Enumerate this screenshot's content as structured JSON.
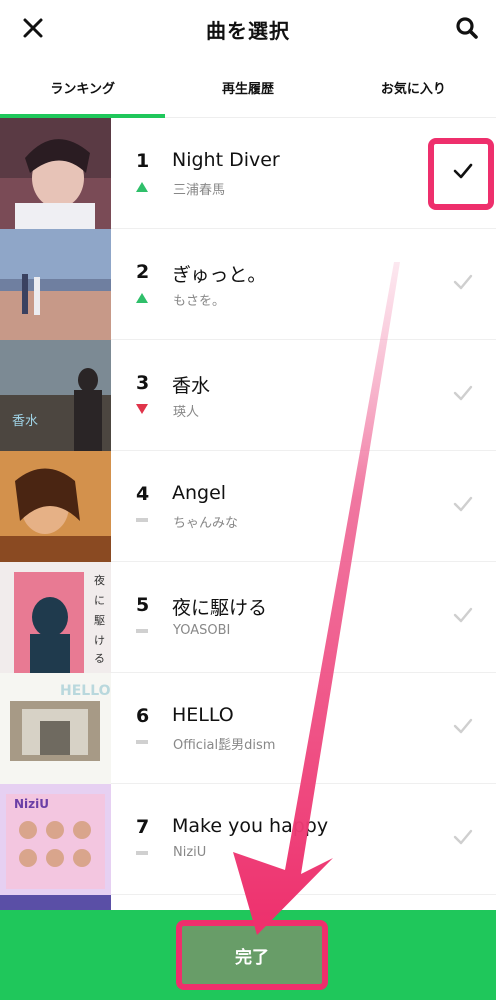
{
  "header": {
    "title": "曲を選択",
    "close_icon": "close-icon",
    "search_icon": "search-icon"
  },
  "tabs": [
    {
      "label": "ランキング",
      "active": true
    },
    {
      "label": "再生履歴",
      "active": false
    },
    {
      "label": "お気に入り",
      "active": false
    }
  ],
  "songs": [
    {
      "rank": "1",
      "title": "Night Diver",
      "artist": "三浦春馬",
      "trend": "up",
      "selected": true
    },
    {
      "rank": "2",
      "title": "ぎゅっと。",
      "artist": "もさを。",
      "trend": "up",
      "selected": false
    },
    {
      "rank": "3",
      "title": "香水",
      "artist": "瑛人",
      "trend": "down",
      "selected": false
    },
    {
      "rank": "4",
      "title": "Angel",
      "artist": "ちゃんみな",
      "trend": "same",
      "selected": false
    },
    {
      "rank": "5",
      "title": "夜に駆ける",
      "artist": "YOASOBI",
      "trend": "same",
      "selected": false
    },
    {
      "rank": "6",
      "title": "HELLO",
      "artist": "Official髭男dism",
      "trend": "same",
      "selected": false
    },
    {
      "rank": "7",
      "title": "Make you happy",
      "artist": "NiziU",
      "trend": "same",
      "selected": false
    }
  ],
  "footer": {
    "done_label": "完了"
  },
  "colors": {
    "accent": "#1fc75b",
    "highlight": "#ee2f6c",
    "trend_up": "#2fbf6a",
    "trend_down": "#e0344a",
    "check_inactive": "#cfcfcf"
  }
}
